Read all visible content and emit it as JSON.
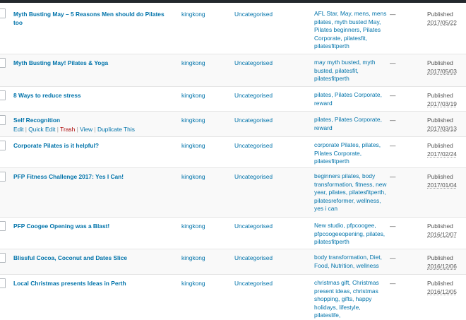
{
  "posts": [
    {
      "title": "Myth Busting May – 5 Reasons Men should do Pilates too",
      "author": "kingkong",
      "category": "Uncategorised",
      "tags": "AFL Star, May, mens, mens pilates, myth busted May, Pilates beginners, Pilates Corporate, pilatesfit, pilatesfitperth",
      "comments": "—",
      "status": "Published",
      "date": "2017/05/22"
    },
    {
      "title": "Myth Busting May! Pilates & Yoga",
      "author": "kingkong",
      "category": "Uncategorised",
      "tags": "may myth busted, myth busted, pilatesfit, pilatesfitperth",
      "comments": "—",
      "status": "Published",
      "date": "2017/05/03"
    },
    {
      "title": "8 Ways to reduce stress",
      "author": "kingkong",
      "category": "Uncategorised",
      "tags": "pilates, Pilates Corporate, reward",
      "comments": "—",
      "status": "Published",
      "date": "2017/03/19"
    },
    {
      "title": "Self Recognition",
      "author": "kingkong",
      "category": "Uncategorised",
      "tags": "pilates, Pilates Corporate, reward",
      "comments": "—",
      "status": "Published",
      "date": "2017/03/13"
    },
    {
      "title": "Corporate Pilates is it helpful?",
      "author": "kingkong",
      "category": "Uncategorised",
      "tags": "corporate Pilates, pilates, Pilates Corporate, pilatesfitperth",
      "comments": "—",
      "status": "Published",
      "date": "2017/02/24"
    },
    {
      "title": "PFP Fitness Challenge 2017: Yes I Can!",
      "author": "kingkong",
      "category": "Uncategorised",
      "tags": "beginners pilates, body transformation, fitness, new year, pilates, pilatesfitperth, pilatesreformer, wellness, yes i can",
      "comments": "—",
      "status": "Published",
      "date": "2017/01/04"
    },
    {
      "title": "PFP Coogee Opening was a Blast!",
      "author": "kingkong",
      "category": "Uncategorised",
      "tags": "New studio, pfpcoogee, pfpcoogeeopening, pilates, pilatesfitperth",
      "comments": "—",
      "status": "Published",
      "date": "2016/12/07"
    },
    {
      "title": "Blissful Cocoa, Coconut and Dates Slice",
      "author": "kingkong",
      "category": "Uncategorised",
      "tags": "body transformation, Diet, Food, Nutrition, wellness",
      "comments": "—",
      "status": "Published",
      "date": "2016/12/06"
    },
    {
      "title": "Local Christmas presents Ideas in Perth",
      "author": "kingkong",
      "category": "Uncategorised",
      "tags": "christmas gift, Christmas present ideas, christmas shopping, gifts, happy holidays, lifestyle, pilateslife,",
      "comments": "—",
      "status": "Published",
      "date": "2016/12/05"
    }
  ],
  "row_actions": {
    "edit": "Edit",
    "quick_edit": "Quick Edit",
    "trash": "Trash",
    "view": "View",
    "duplicate": "Duplicate This",
    "separator": "|"
  }
}
